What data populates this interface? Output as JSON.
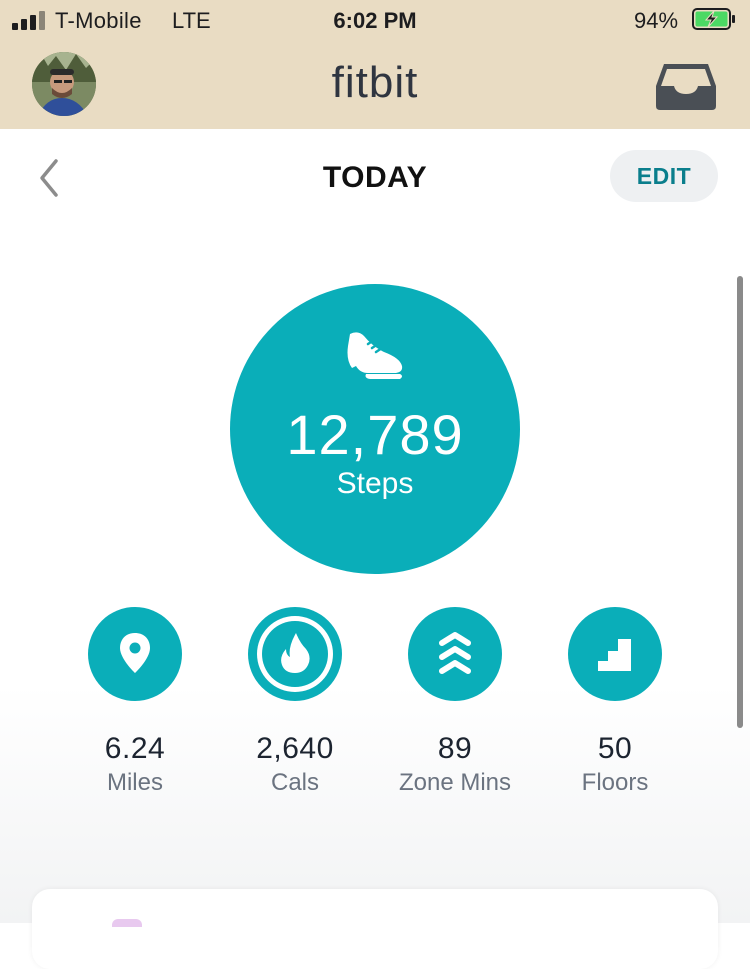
{
  "status_bar": {
    "carrier": "T-Mobile",
    "network": "LTE",
    "time": "6:02 PM",
    "battery_percent": "94%",
    "battery_level": 0.94,
    "signal_bars": 3
  },
  "app_bar": {
    "title": "fitbit"
  },
  "nav": {
    "title": "TODAY",
    "edit_label": "EDIT"
  },
  "steps": {
    "value": "12,789",
    "label": "Steps",
    "icon": "shoe-icon"
  },
  "stats": [
    {
      "value": "6.24",
      "label": "Miles",
      "icon": "location-pin-icon"
    },
    {
      "value": "2,640",
      "label": "Cals",
      "icon": "flame-icon"
    },
    {
      "value": "89",
      "label": "Zone Mins",
      "icon": "chevrons-up-icon"
    },
    {
      "value": "50",
      "label": "Floors",
      "icon": "stairs-icon"
    }
  ],
  "colors": {
    "accent": "#0aaeb9",
    "header_bg": "#e9dcc3",
    "edit_text": "#0a7e8c",
    "battery_green": "#4cd964"
  }
}
